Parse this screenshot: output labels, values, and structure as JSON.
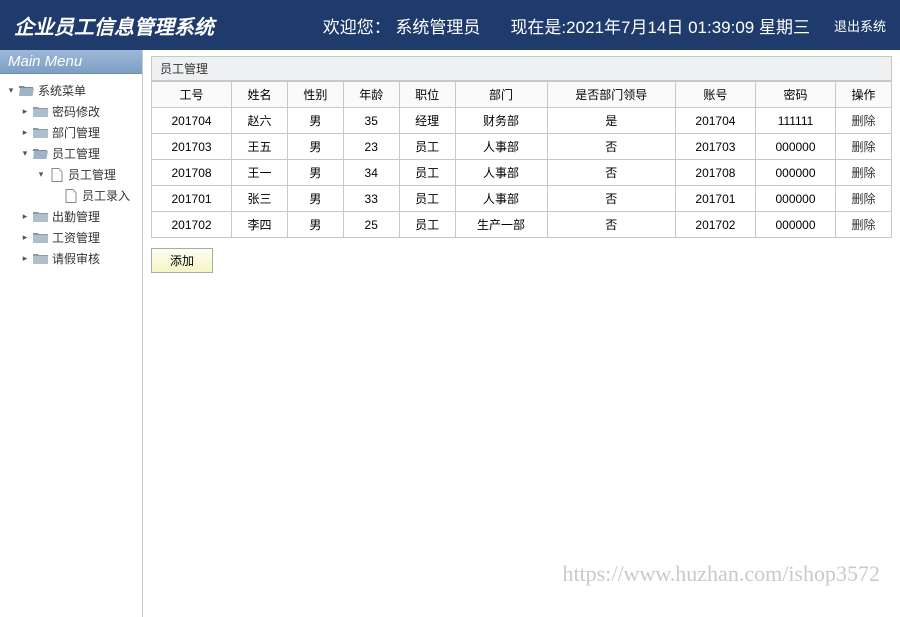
{
  "header": {
    "title": "企业员工信息管理系统",
    "welcome_prefix": "欢迎您：",
    "welcome_user": "系统管理员",
    "time_prefix": "现在是:",
    "time_value": "2021年7月14日 01:39:09 星期三",
    "logout": "退出系统"
  },
  "sidebar": {
    "title": "Main Menu",
    "root": "系统菜单",
    "items": {
      "password": "密码修改",
      "dept": "部门管理",
      "emp": "员工管理",
      "emp_manage": "员工管理",
      "emp_entry": "员工录入",
      "attendance": "出勤管理",
      "salary": "工资管理",
      "leave": "请假审核"
    }
  },
  "panel": {
    "title": "员工管理",
    "add_button": "添加"
  },
  "table": {
    "headers": {
      "id": "工号",
      "name": "姓名",
      "gender": "性别",
      "age": "年龄",
      "position": "职位",
      "dept": "部门",
      "leader": "是否部门领导",
      "account": "账号",
      "password": "密码",
      "action": "操作"
    },
    "action_label": "删除",
    "rows": [
      {
        "id": "201704",
        "name": "赵六",
        "gender": "男",
        "age": "35",
        "position": "经理",
        "dept": "财务部",
        "leader": "是",
        "account": "201704",
        "password": "111111"
      },
      {
        "id": "201703",
        "name": "王五",
        "gender": "男",
        "age": "23",
        "position": "员工",
        "dept": "人事部",
        "leader": "否",
        "account": "201703",
        "password": "000000"
      },
      {
        "id": "201708",
        "name": "王一",
        "gender": "男",
        "age": "34",
        "position": "员工",
        "dept": "人事部",
        "leader": "否",
        "account": "201708",
        "password": "000000"
      },
      {
        "id": "201701",
        "name": "张三",
        "gender": "男",
        "age": "33",
        "position": "员工",
        "dept": "人事部",
        "leader": "否",
        "account": "201701",
        "password": "000000"
      },
      {
        "id": "201702",
        "name": "李四",
        "gender": "男",
        "age": "25",
        "position": "员工",
        "dept": "生产一部",
        "leader": "否",
        "account": "201702",
        "password": "000000"
      }
    ]
  },
  "watermark": "https://www.huzhan.com/ishop3572"
}
